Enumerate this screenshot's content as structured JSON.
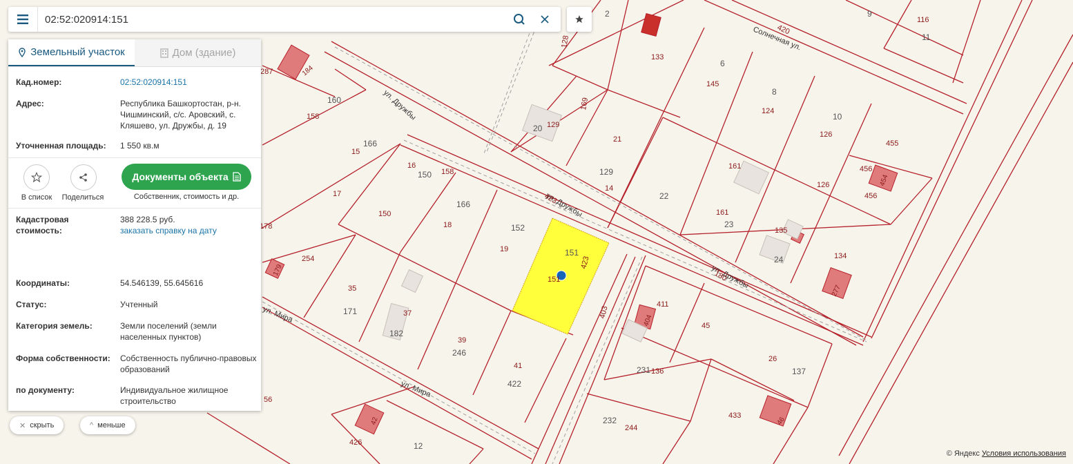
{
  "search": {
    "value": "02:52:020914:151"
  },
  "panel": {
    "tabs": [
      {
        "label": "Земельный участок",
        "active": true
      },
      {
        "label": "Дом (здание)",
        "active": false
      }
    ],
    "cadastral_number": {
      "label": "Кад.номер:",
      "value": "02:52:020914:151"
    },
    "address": {
      "label": "Адрес:",
      "value": "Республика Башкортостан, р-н. Чишминский, с/с. Аровский, с. Кляшево, ул. Дружбы, д. 19"
    },
    "area": {
      "label": "Уточненная площадь:",
      "value": "1 550 кв.м"
    },
    "actions": {
      "add_to_list": "В список",
      "share": "Поделиться",
      "documents_button": "Документы объекта",
      "documents_sub": "Собственник, стоимость и др."
    },
    "cost": {
      "label": "Кадастровая стоимость:",
      "value": "388 228.5 руб.",
      "link": "заказать справку на дату"
    },
    "coordinates": {
      "label": "Координаты:",
      "value": "54.546139, 55.645616"
    },
    "status": {
      "label": "Статус:",
      "value": "Учтенный"
    },
    "category": {
      "label": "Категория земель:",
      "value": "Земли поселений (земли населенных пунктов)"
    },
    "ownership": {
      "label": "Форма собственности:",
      "value": "Собственность публично-правовых образований"
    },
    "by_document": {
      "label": "по документу:",
      "value": "Индивидуальное жилищное строительство"
    }
  },
  "controls": {
    "hide": "скрыть",
    "less": "меньше"
  },
  "attribution": {
    "provider": "© Яндекс",
    "terms": "Условия использования"
  },
  "map": {
    "streets": [
      "ул. Дружбы",
      "ул. Дружбы",
      "ул. Дружбы",
      "ул. Мира",
      "ул. Мира",
      "Солнечная ул."
    ],
    "parcel_numbers": [
      "128",
      "2",
      "9",
      "116",
      "11",
      "133",
      "420",
      "6",
      "145",
      "8",
      "124",
      "10",
      "126",
      "455",
      "456",
      "454",
      "456",
      "126",
      "161",
      "161",
      "23",
      "22",
      "135",
      "24",
      "134",
      "277",
      "169",
      "20",
      "129",
      "21",
      "129",
      "14",
      "160",
      "158",
      "15",
      "166",
      "16",
      "150",
      "158",
      "17",
      "166",
      "150",
      "18",
      "152",
      "19",
      "151",
      "151",
      "423",
      "423",
      "180",
      "178",
      "254",
      "179",
      "35",
      "171",
      "37",
      "182",
      "39",
      "246",
      "41",
      "422",
      "403",
      "411",
      "404",
      "45",
      "231",
      "136",
      "26",
      "137",
      "433",
      "46",
      "232",
      "244",
      "426",
      "42",
      "12",
      "56",
      "287",
      "184"
    ],
    "colors": {
      "highlight": "#ffff3c",
      "parcel_line": "#b5202a",
      "building": "#e07b7b",
      "building_gray": "#e8e3df"
    }
  }
}
